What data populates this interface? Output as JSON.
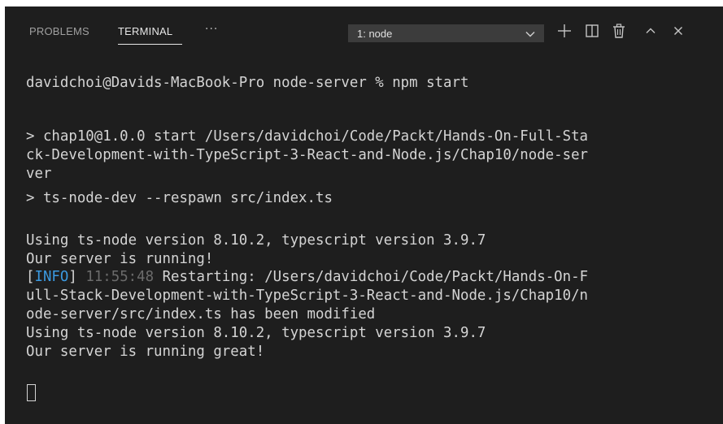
{
  "tabs": {
    "problems": "PROBLEMS",
    "terminal": "TERMINAL",
    "more": "···"
  },
  "terminal_select": {
    "value": "1: node"
  },
  "toolbar_icons": [
    "plus-icon",
    "split-icon",
    "trash-icon",
    "chevron-up-icon",
    "close-icon"
  ],
  "colors": {
    "background": "#1e1e1e",
    "text": "#d4d4d4",
    "info": "#3b9ae1",
    "timestamp": "#6b6b6b"
  },
  "terminal": {
    "lines": [
      "davidchoi@Davids-MacBook-Pro node-server % npm start",
      "",
      "> chap10@1.0.0 start /Users/davidchoi/Code/Packt/Hands-On-Full-Sta",
      "ck-Development-with-TypeScript-3-React-and-Node.js/Chap10/node-ser",
      "ver",
      "> ts-node-dev --respawn src/index.ts",
      "",
      "Using ts-node version 8.10.2, typescript version 3.9.7",
      "Our server is running!"
    ],
    "info_prefix_open": "[",
    "info_tag": "INFO",
    "info_prefix_close": "] ",
    "info_time": "11:55:48",
    "info_rest": " Restarting: /Users/davidchoi/Code/Packt/Hands-On-F",
    "lines_after": [
      "ull-Stack-Development-with-TypeScript-3-React-and-Node.js/Chap10/n",
      "ode-server/src/index.ts has been modified",
      "Using ts-node version 8.10.2, typescript version 3.9.7",
      "Our server is running great!"
    ]
  }
}
